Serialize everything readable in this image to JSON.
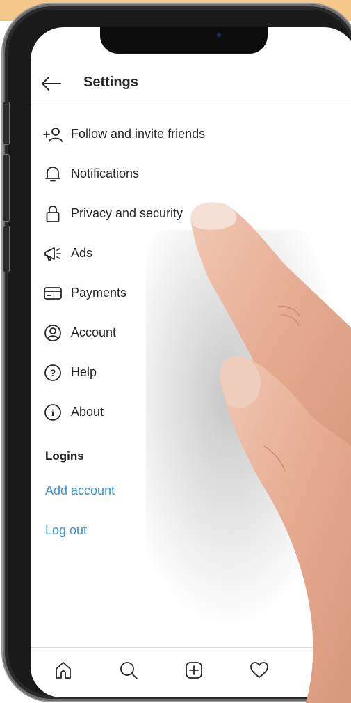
{
  "header": {
    "title": "Settings"
  },
  "menu": [
    {
      "label": "Follow and invite friends",
      "icon": "add-person-icon"
    },
    {
      "label": "Notifications",
      "icon": "bell-icon"
    },
    {
      "label": "Privacy and security",
      "icon": "lock-icon"
    },
    {
      "label": "Ads",
      "icon": "megaphone-icon"
    },
    {
      "label": "Payments",
      "icon": "card-icon"
    },
    {
      "label": "Account",
      "icon": "account-circle-icon"
    },
    {
      "label": "Help",
      "icon": "question-circle-icon"
    },
    {
      "label": "About",
      "icon": "info-circle-icon"
    }
  ],
  "logins": {
    "title": "Logins",
    "add_account": "Add account",
    "log_out": "Log out"
  },
  "tabs": [
    "home-icon",
    "search-icon",
    "new-post-icon",
    "activity-heart-icon",
    "profile-icon"
  ],
  "colors": {
    "link": "#3b8ed8",
    "text": "#262626",
    "background_top": "#f3c88a"
  }
}
